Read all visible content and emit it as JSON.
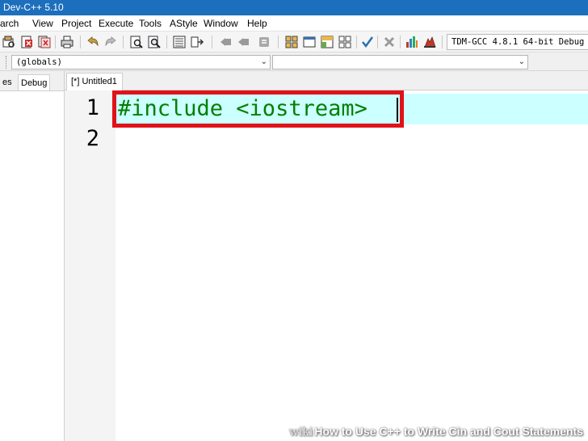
{
  "title_bar": {
    "title": "Dev-C++ 5.10"
  },
  "menu": [
    {
      "label": "arch"
    },
    {
      "label": "View"
    },
    {
      "label": "Project"
    },
    {
      "label": "Execute"
    },
    {
      "label": "Tools"
    },
    {
      "label": "AStyle"
    },
    {
      "label": "Window"
    },
    {
      "label": "Help"
    }
  ],
  "toolbar": {
    "icons": [
      "print-preview-icon",
      "close-file-icon",
      "close-all-icon",
      "print-icon",
      "undo-icon",
      "redo-icon",
      "find-icon",
      "replace-icon",
      "indent-icon",
      "unindent-icon",
      "goto-back-icon",
      "goto-forward-icon",
      "bookmark-icon",
      "compile-icon",
      "run-icon",
      "compile-run-icon",
      "rebuild-icon",
      "syntax-check-icon",
      "stop-icon",
      "chart-icon",
      "debug-icon"
    ],
    "compiler_value": "TDM-GCC 4.8.1 64-bit Debug"
  },
  "scope_bar": {
    "class_combo": "(globals)",
    "member_combo": ""
  },
  "left_panel": {
    "tabs": [
      {
        "label": "es"
      },
      {
        "label": "Debug"
      }
    ]
  },
  "editor": {
    "tab_label": "[*] Untitled1",
    "line_numbers": [
      "1",
      "2"
    ],
    "line1": "#include <iostream>",
    "highlight_color": "#e0121a",
    "current_line_color": "#ccffff",
    "code_color": "#008000"
  },
  "watermark": {
    "brand": "wiki",
    "text": "How to Use C++ to Write Cin and Cout Statements"
  }
}
